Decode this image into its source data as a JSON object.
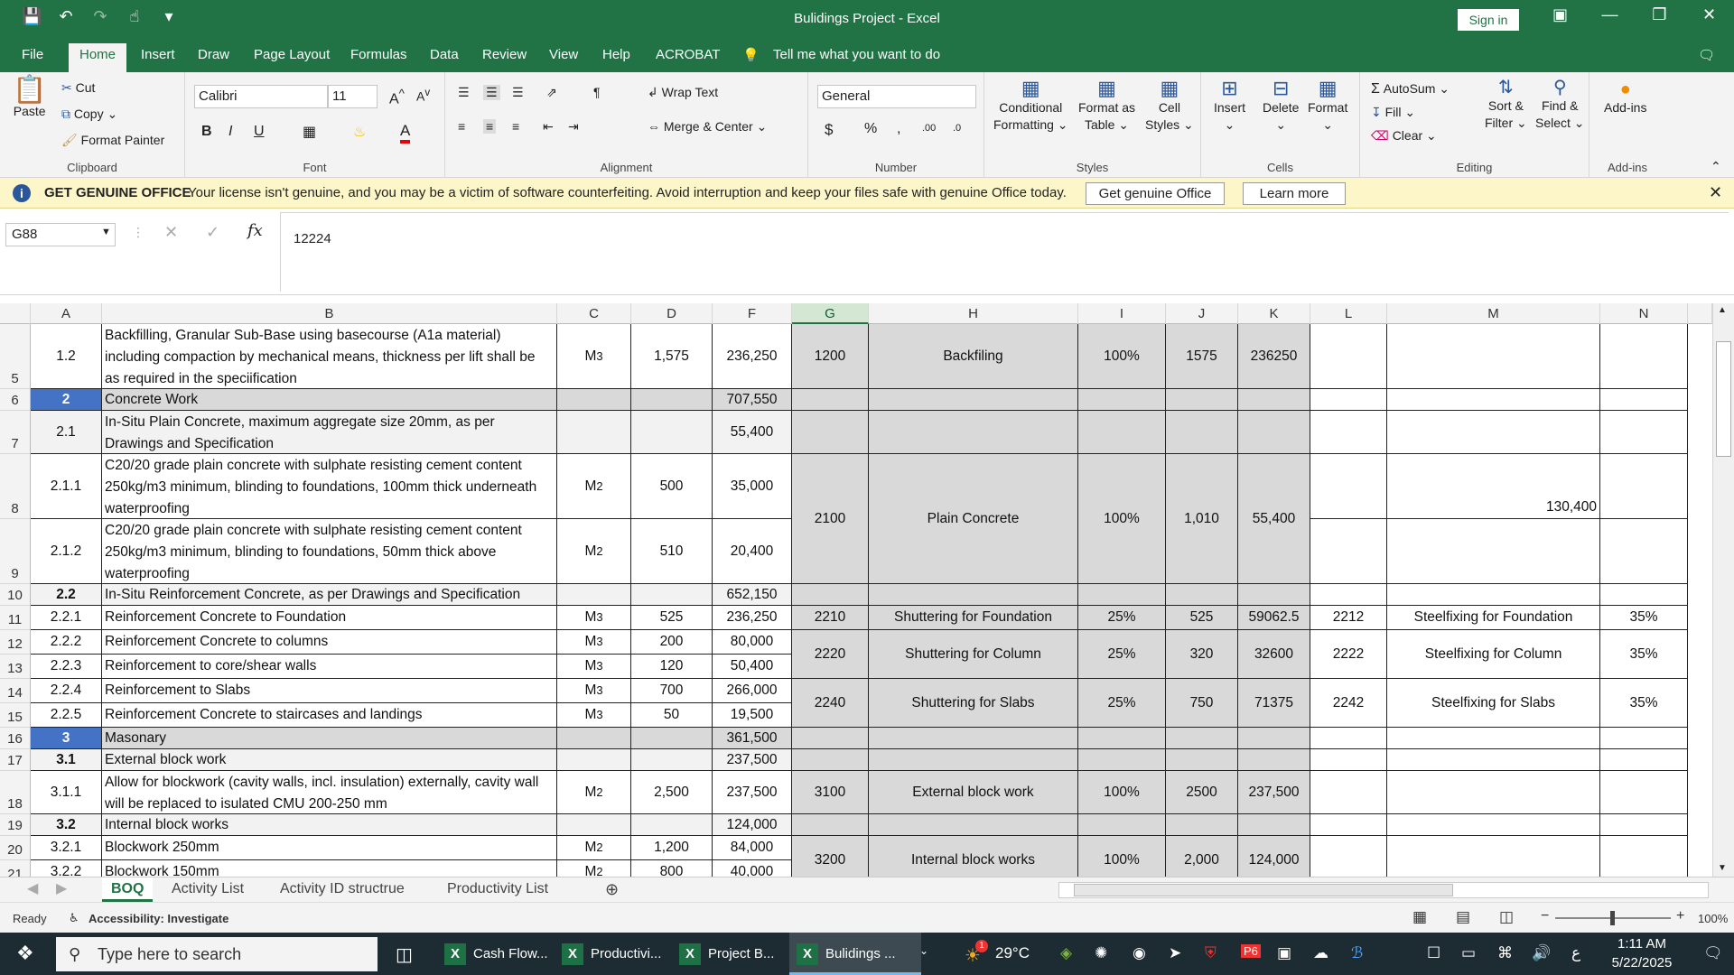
{
  "title": "Bulidings Project  -  Excel",
  "signin": "Sign in",
  "menu_tabs": [
    "File",
    "Home",
    "Insert",
    "Draw",
    "Page Layout",
    "Formulas",
    "Data",
    "Review",
    "View",
    "Help",
    "ACROBAT"
  ],
  "tell_me": "Tell me what you want to do",
  "ribbon": {
    "clipboard": {
      "paste": "Paste",
      "cut": "Cut",
      "copy": "Copy",
      "format_painter": "Format Painter",
      "label": "Clipboard"
    },
    "font": {
      "name": "Calibri",
      "size": "11",
      "label": "Font"
    },
    "alignment": {
      "wrap": "Wrap Text",
      "merge": "Merge & Center",
      "label": "Alignment"
    },
    "number": {
      "format": "General",
      "label": "Number"
    },
    "styles": {
      "conditional": "Conditional",
      "conditional2": "Formatting",
      "format_as": "Format as",
      "format_as2": "Table",
      "cell": "Cell",
      "cell2": "Styles",
      "label": "Styles"
    },
    "cells": {
      "insert": "Insert",
      "delete": "Delete",
      "format": "Format",
      "label": "Cells"
    },
    "editing": {
      "autosum": "AutoSum",
      "fill": "Fill",
      "clear": "Clear",
      "sort": "Sort &",
      "sort2": "Filter",
      "find": "Find &",
      "find2": "Select",
      "label": "Editing"
    },
    "addins": {
      "btn": "Add-ins",
      "label": "Add-ins"
    }
  },
  "message": {
    "heading": "GET GENUINE OFFICE",
    "text": "Your license isn't genuine, and you may be a victim of software counterfeiting. Avoid interruption and keep your files safe with genuine Office today.",
    "btn1": "Get genuine Office",
    "btn2": "Learn more"
  },
  "formula_bar": {
    "name_box": "G88",
    "formula": "12224"
  },
  "columns": [
    "A",
    "B",
    "C",
    "D",
    "F",
    "G",
    "H",
    "I",
    "J",
    "K",
    "L",
    "M",
    "N"
  ],
  "rows": [
    "5",
    "6",
    "7",
    "8",
    "9",
    "10",
    "11",
    "12",
    "13",
    "14",
    "15",
    "16",
    "17",
    "18",
    "19",
    "20",
    "21"
  ],
  "cells": {
    "r5": {
      "a": "1.2",
      "b": "Backfilling, Granular Sub-Base using basecourse (A1a material) including compaction by mechanical means, thickness per lift shall be as required in the speciification",
      "c": "M",
      "d": "1,575",
      "f": "236,250",
      "g": "1200",
      "h": "Backfiling",
      "i": "100%",
      "j": "1575",
      "k": "236250"
    },
    "r6": {
      "a": "2",
      "b": "Concrete Work",
      "f": "707,550"
    },
    "r7": {
      "a": "2.1",
      "b": "In-Situ Plain Concrete, maximum aggregate size 20mm, as per Drawings and Specification",
      "f": "55,400"
    },
    "r8": {
      "a": "2.1.1",
      "b": "C20/20 grade plain concrete with sulphate resisting cement content 250kg/m3 minimum, blinding to foundations, 100mm thick underneath waterproofing",
      "c": "M",
      "d": "500",
      "f": "35,000",
      "g": "2100",
      "h": "Plain Concrete",
      "i": "100%",
      "j": "1,010",
      "k": "55,400",
      "m": "130,400"
    },
    "r9": {
      "a": "2.1.2",
      "b": "C20/20 grade plain concrete with sulphate resisting cement content 250kg/m3 minimum, blinding to foundations, 50mm thick above waterproofing",
      "c": "M",
      "d": "510",
      "f": "20,400"
    },
    "r10": {
      "a": "2.2",
      "b": "In-Situ Reinforcement Concrete, as per Drawings and Specification",
      "f": "652,150"
    },
    "r11": {
      "a": "2.2.1",
      "b": "Reinforcement Concrete to Foundation",
      "c": "M",
      "d": "525",
      "f": "236,250",
      "g": "2210",
      "h": "Shuttering for Foundation",
      "i": "25%",
      "j": "525",
      "k": "59062.5",
      "l": "2212",
      "m": "Steelfixing for Foundation",
      "n": "35%"
    },
    "r12": {
      "a": "2.2.2",
      "b": "Reinforcement Concrete to columns",
      "c": "M",
      "d": "200",
      "f": "80,000",
      "g": "2220",
      "h": "Shuttering for Column",
      "i": "25%",
      "j": "320",
      "k": "32600",
      "l": "2222",
      "m": "Steelfixing for Column",
      "n": "35%"
    },
    "r13": {
      "a": "2.2.3",
      "b": "Reinforcement to core/shear walls",
      "c": "M",
      "d": "120",
      "f": "50,400"
    },
    "r14": {
      "a": "2.2.4",
      "b": "Reinforcement to Slabs",
      "c": "M",
      "d": "700",
      "f": "266,000",
      "g": "2240",
      "h": "Shuttering for Slabs",
      "i": "25%",
      "j": "750",
      "k": "71375",
      "l": "2242",
      "m": "Steelfixing for Slabs",
      "n": "35%"
    },
    "r15": {
      "a": "2.2.5",
      "b": "Reinforcement Concrete to staircases and landings",
      "c": "M",
      "d": "50",
      "f": "19,500"
    },
    "r16": {
      "a": "3",
      "b": "Masonary",
      "f": "361,500"
    },
    "r17": {
      "a": "3.1",
      "b": "External block work",
      "f": "237,500"
    },
    "r18": {
      "a": "3.1.1",
      "b": "Allow for blockwork (cavity walls, incl. insulation) externally,  cavity wall will be replaced to isulated CMU 200-250 mm",
      "c": "M",
      "d": "2,500",
      "f": "237,500",
      "g": "3100",
      "h": "External block work",
      "i": "100%",
      "j": "2500",
      "k": "237,500"
    },
    "r19": {
      "a": "3.2",
      "b": "Internal block works",
      "f": "124,000"
    },
    "r20": {
      "a": "3.2.1",
      "b": "Blockwork 250mm",
      "c": "M",
      "d": "1,200",
      "f": "84,000",
      "g": "3200",
      "h": "Internal block works",
      "i": "100%",
      "j": "2,000",
      "k": "124,000"
    },
    "r21": {
      "a": "3.2.2",
      "b": "Blockwork 150mm",
      "c": "M",
      "d": "800",
      "f": "40,000"
    }
  },
  "sheet_tabs": [
    "BOQ",
    "Activity List",
    "Activity ID structrue",
    "Productivity List"
  ],
  "status": {
    "ready": "Ready",
    "accessibility": "Accessibility: Investigate",
    "zoom": "100%"
  },
  "taskbar": {
    "search": "Type here to search",
    "apps": [
      "Cash Flow...",
      "Productivi...",
      "Project B...",
      "Bulidings ..."
    ],
    "temp": "29°C",
    "time": "1:11 AM",
    "date": "5/22/2025",
    "lang": "ع",
    "badge": "1"
  }
}
